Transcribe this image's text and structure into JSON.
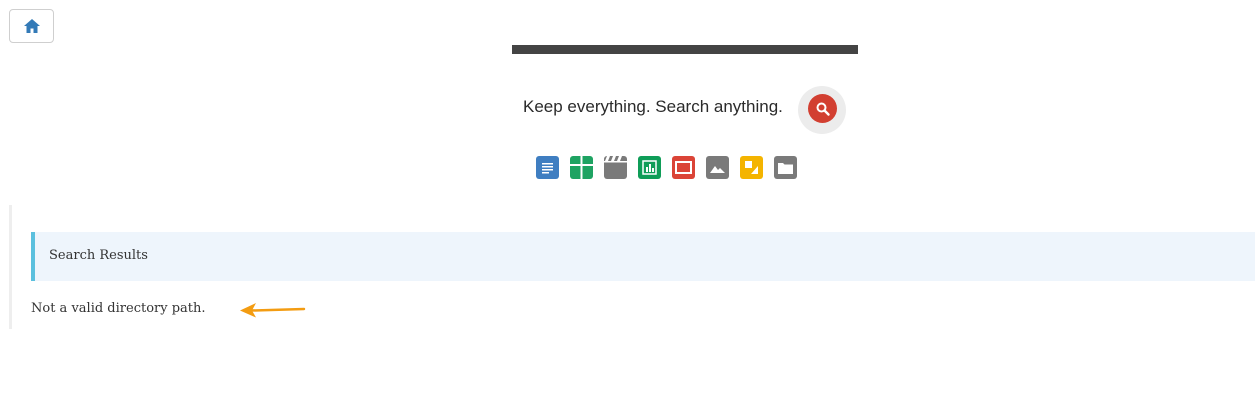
{
  "toolbar": {
    "home_icon": "home-icon"
  },
  "banner": {
    "tagline": "Keep everything. Search anything.",
    "search_icon": "magnifier-icon",
    "search_color": "#d23f31",
    "file_types": [
      {
        "icon": "document-icon",
        "color": "#3f7ec1"
      },
      {
        "icon": "spreadsheet-icon",
        "color": "#1ea362"
      },
      {
        "icon": "video-icon",
        "color": "#7a7a7a"
      },
      {
        "icon": "chart-icon",
        "color": "#0f9d58"
      },
      {
        "icon": "presentation-icon",
        "color": "#db4437"
      },
      {
        "icon": "image-icon",
        "color": "#7a7a7a"
      },
      {
        "icon": "slides-icon",
        "color": "#f4b400"
      },
      {
        "icon": "folder-icon",
        "color": "#7a7a7a"
      }
    ]
  },
  "results": {
    "title": "Search Results",
    "message": "Not a valid directory path.",
    "accent_color": "#5bc0de",
    "arrow_color": "#f39c12"
  }
}
